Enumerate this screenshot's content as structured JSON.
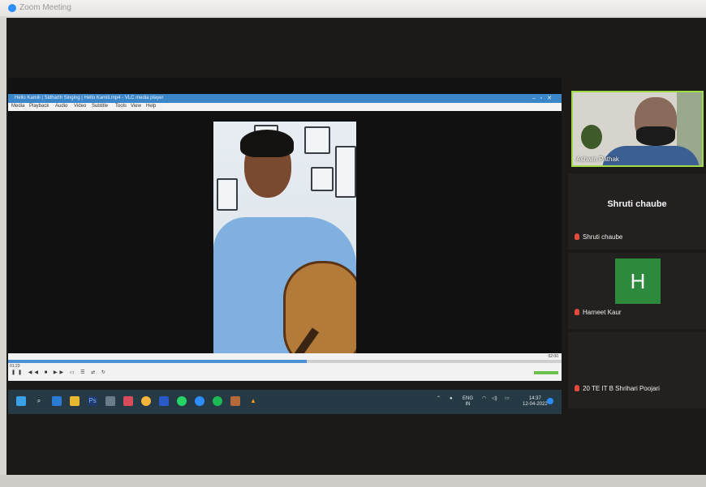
{
  "zoom": {
    "window_title": "Zoom Meeting"
  },
  "vlc": {
    "window_title": "Hello Kamili | Sidharth Singing | Hello Kamili.mp4 - VLC media player",
    "menu": [
      "Media",
      "Playback",
      "Audio",
      "Video",
      "Subtitle",
      "Tools",
      "View",
      "Help"
    ],
    "time_elapsed": "01:23",
    "time_total": "02:00",
    "progress_fraction": 0.54
  },
  "taskbar": {
    "lang_line1": "ENG",
    "lang_line2": "IN",
    "clock_time": "14:37",
    "clock_date": "12-04-2022"
  },
  "participants": {
    "self_name": "Ashwin Pathak",
    "active_name_large": "Shruti chaube",
    "tile_shruti": "Shruti chaube",
    "avatar_letter": "H",
    "tile_harneet": "Harneet Kaur",
    "tile_shrihari": "20 TE IT B Shrihari Poojari"
  },
  "colors": {
    "self_tile_border": "#9fdc46",
    "avatar_bg": "#2d8a3c",
    "muted_mic": "#e34a3c"
  }
}
